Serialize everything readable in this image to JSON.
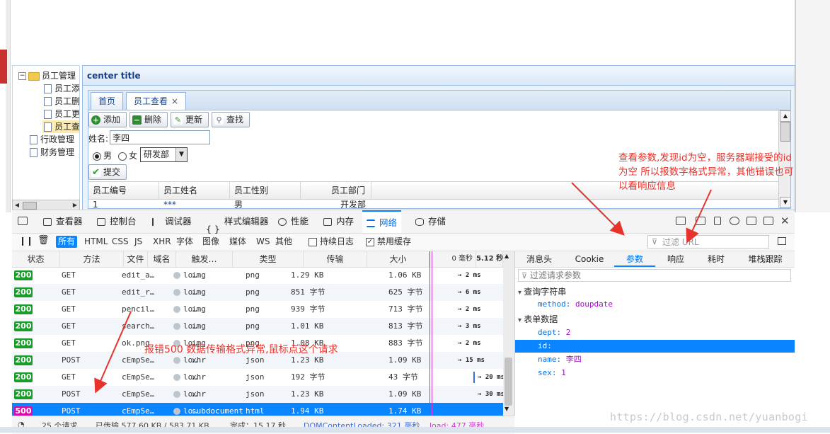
{
  "tree": {
    "root": "员工管理",
    "children": [
      "员工添",
      "员工删",
      "员工更",
      "员工查"
    ],
    "others": [
      "行政管理",
      "财务管理"
    ],
    "toggle": "−"
  },
  "center": {
    "title": "center title",
    "tabs": [
      {
        "label": "首页"
      },
      {
        "label": "员工查看",
        "close": "×"
      }
    ],
    "toolbar": [
      {
        "label": "添加",
        "icon": "plus-icon",
        "color": "#2e8b2e",
        "glyph": "+"
      },
      {
        "label": "删除",
        "icon": "minus-icon",
        "color": "#2e8b2e",
        "glyph": "−"
      },
      {
        "label": "更新",
        "icon": "pencil-icon",
        "color": "#3a8e2a",
        "glyph": "✎"
      },
      {
        "label": "查找",
        "icon": "search-icon",
        "color": "#6b8fbf",
        "glyph": "⚲"
      }
    ],
    "form": {
      "name_label": "姓名:",
      "name_value": "李四",
      "gender_male": "男",
      "gender_female": "女",
      "dept_value": "研发部",
      "submit": "提交"
    },
    "grid": {
      "headers": [
        "员工编号",
        "员工姓名",
        "员工性别",
        "员工部门"
      ],
      "partial_row": [
        "1",
        "***",
        "男",
        "开发部"
      ]
    }
  },
  "annotations": {
    "top": [
      "查看参数,发现id为空，服务器端接受的id",
      "为空 所以报数字格式异常，其他错误也可",
      "以看响应信息"
    ],
    "middle": "报错500 数据传输格式异常,鼠标点这个请求"
  },
  "devtools": {
    "tabs": [
      "查看器",
      "控制台",
      "调试器",
      "样式编辑器",
      "性能",
      "内存",
      "网络",
      "存储"
    ],
    "active_tab": "网络",
    "filters": [
      "所有",
      "HTML",
      "CSS",
      "JS",
      "XHR",
      "字体",
      "图像",
      "媒体",
      "WS",
      "其他"
    ],
    "active_filter": "所有",
    "persist_logs": "持续日志",
    "disable_cache": "禁用缓存",
    "url_filter_placeholder": "过滤 URL",
    "columns": [
      "状态",
      "方法",
      "文件",
      "域名",
      "触发…",
      "类型",
      "传输",
      "大小",
      "0 毫秒",
      "5.12 秒"
    ],
    "requests": [
      {
        "status": "200",
        "method": "GET",
        "file": "edit_a…",
        "domain": "lo…",
        "cause": "img",
        "type": "png",
        "transferred": "1.29 KB",
        "size": "1.06 KB",
        "timing": "→ 2 ms"
      },
      {
        "status": "200",
        "method": "GET",
        "file": "edit_r…",
        "domain": "lo…",
        "cause": "img",
        "type": "png",
        "transferred": "851 字节",
        "size": "625 字节",
        "timing": "→ 6 ms"
      },
      {
        "status": "200",
        "method": "GET",
        "file": "pencil…",
        "domain": "lo…",
        "cause": "img",
        "type": "png",
        "transferred": "939 字节",
        "size": "713 字节",
        "timing": "→ 2 ms"
      },
      {
        "status": "200",
        "method": "GET",
        "file": "search…",
        "domain": "lo…",
        "cause": "img",
        "type": "png",
        "transferred": "1.01 KB",
        "size": "813 字节",
        "timing": "→ 3 ms"
      },
      {
        "status": "200",
        "method": "GET",
        "file": "ok.png",
        "domain": "lo…",
        "cause": "img",
        "type": "png",
        "transferred": "1.08 KB",
        "size": "883 字节",
        "timing": "→ 2 ms"
      },
      {
        "status": "200",
        "method": "POST",
        "file": "cEmpSe…",
        "domain": "lo…",
        "cause": "xhr",
        "type": "json",
        "transferred": "1.23 KB",
        "size": "1.09 KB",
        "timing": "→ 15 ms"
      },
      {
        "status": "200",
        "method": "GET",
        "file": "cEmpSe…",
        "domain": "lo…",
        "cause": "xhr",
        "type": "json",
        "transferred": "192 字节",
        "size": "43 字节",
        "timing": "→ 20 ms"
      },
      {
        "status": "200",
        "method": "POST",
        "file": "cEmpSe…",
        "domain": "lo…",
        "cause": "xhr",
        "type": "json",
        "transferred": "1.23 KB",
        "size": "1.09 KB",
        "timing": "→ 30 ms"
      },
      {
        "status": "500",
        "method": "POST",
        "file": "cEmpSe…",
        "domain": "lo…",
        "cause": "subdocument",
        "type": "html",
        "transferred": "1.94 KB",
        "size": "1.74 KB",
        "timing": ""
      }
    ],
    "status_bar": {
      "requests": "25 个请求",
      "transferred": "已传输 577.60 KB / 583.71 KB",
      "finish": "完成：15.17 秒",
      "dom": "DOMContentLoaded: 321 毫秒",
      "load": "load: 477 毫秒"
    },
    "detail_tabs": [
      "消息头",
      "Cookie",
      "参数",
      "响应",
      "耗时",
      "堆栈跟踪"
    ],
    "active_detail_tab": "参数",
    "param_filter_placeholder": "过滤请求参数",
    "query_section": "查询字符串",
    "query_params": [
      {
        "key": "method:",
        "value": "doupdate"
      }
    ],
    "form_section": "表单数据",
    "form_params": [
      {
        "key": "dept:",
        "value": "2"
      },
      {
        "key": "id:",
        "value": ""
      },
      {
        "key": "name:",
        "value": "李四"
      },
      {
        "key": "sex:",
        "value": "1"
      }
    ]
  },
  "watermark": "https://blog.csdn.net/yuanbogi",
  "colors": {
    "status_ok": "#1a9c2a",
    "status_error": "#d70fa8",
    "accent": "#0a84ff",
    "annotation": "#e8322c"
  }
}
